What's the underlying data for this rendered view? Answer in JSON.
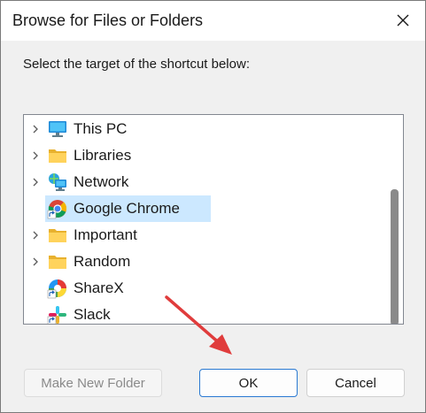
{
  "dialog": {
    "title": "Browse for Files or Folders",
    "close_icon": "close-icon",
    "prompt": "Select the target of the shortcut below:"
  },
  "tree": {
    "items": [
      {
        "label": "This PC",
        "icon": "computer-icon",
        "expandable": true,
        "selected": false
      },
      {
        "label": "Libraries",
        "icon": "folder-icon",
        "expandable": true,
        "selected": false
      },
      {
        "label": "Network",
        "icon": "network-icon",
        "expandable": true,
        "selected": false
      },
      {
        "label": "Google Chrome",
        "icon": "chrome-shortcut-icon",
        "expandable": false,
        "selected": true
      },
      {
        "label": "Important",
        "icon": "folder-icon",
        "expandable": true,
        "selected": false
      },
      {
        "label": "Random",
        "icon": "folder-icon",
        "expandable": true,
        "selected": false
      },
      {
        "label": "ShareX",
        "icon": "sharex-shortcut-icon",
        "expandable": false,
        "selected": false
      },
      {
        "label": "Slack",
        "icon": "slack-shortcut-icon",
        "expandable": false,
        "selected": false
      }
    ],
    "selection_color": "#cce8ff"
  },
  "buttons": {
    "make_new_folder": "Make New Folder",
    "ok": "OK",
    "cancel": "Cancel"
  },
  "colors": {
    "accent": "#2a79d2",
    "annotation_arrow": "#e03c3c"
  }
}
